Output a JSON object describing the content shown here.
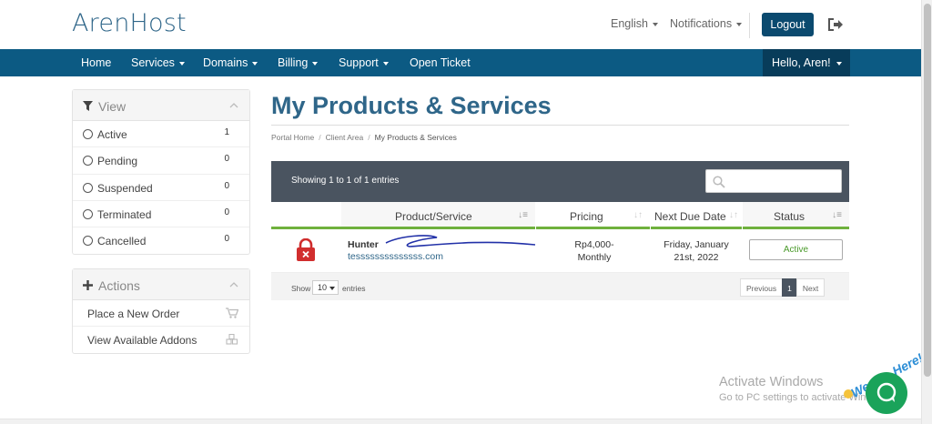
{
  "brand": {
    "name": "ArenHost",
    "accent": "#2f6689",
    "nav_color": "#0c5a83"
  },
  "topbar": {
    "language": "English",
    "notifications": "Notifications",
    "logout": "Logout"
  },
  "nav": {
    "items": [
      "Home",
      "Services",
      "Domains",
      "Billing",
      "Support",
      "Open Ticket"
    ],
    "user": "Hello, Aren!"
  },
  "sidebar": {
    "view": {
      "title": "View",
      "filters": [
        {
          "label": "Active",
          "count": "1"
        },
        {
          "label": "Pending",
          "count": "0"
        },
        {
          "label": "Suspended",
          "count": "0"
        },
        {
          "label": "Terminated",
          "count": "0"
        },
        {
          "label": "Cancelled",
          "count": "0"
        }
      ]
    },
    "actions": {
      "title": "Actions",
      "items": [
        "Place a New Order",
        "View Available Addons"
      ]
    }
  },
  "main": {
    "title": "My Products & Services",
    "breadcrumb": [
      "Portal Home",
      "Client Area",
      "My Products & Services"
    ],
    "table": {
      "showing": "Showing 1 to 1 of 1 entries",
      "search_placeholder": "",
      "columns": [
        "Product/Service",
        "Pricing",
        "Next Due Date",
        "Status"
      ],
      "rows": [
        {
          "product": "Hunter",
          "domain": "tessssssssssssss.com",
          "price_amount": "Rp4,000-",
          "price_cycle": "Monthly",
          "due_line1": "Friday, January",
          "due_line2": "21st, 2022",
          "status": "Active"
        }
      ],
      "footer": {
        "show": "Show",
        "length": "10",
        "entries": "entries",
        "prev": "Previous",
        "page": "1",
        "next": "Next"
      }
    }
  },
  "overlay": {
    "watermark_title": "Activate Windows",
    "watermark_sub": "Go to PC settings to activate Windows.",
    "chat_badge": "We Are Here!"
  }
}
